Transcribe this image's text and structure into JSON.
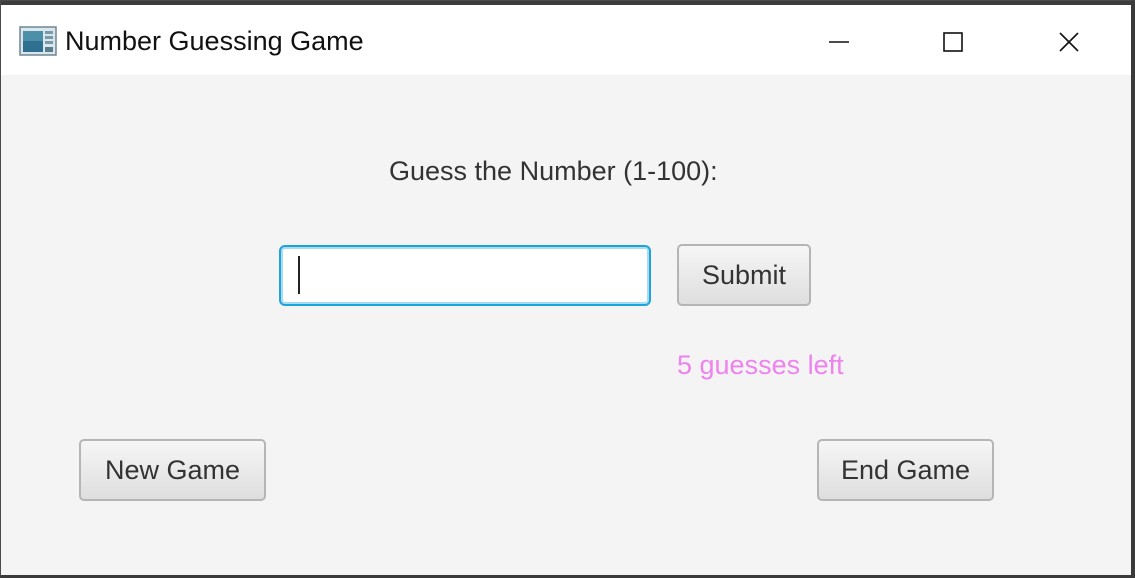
{
  "window": {
    "title": "Number Guessing Game",
    "controls": {
      "minimize": "minimize-icon",
      "maximize": "maximize-icon",
      "close": "close-icon"
    }
  },
  "game": {
    "prompt": "Guess the Number (1-100):",
    "guess_input": {
      "value": "",
      "placeholder": ""
    },
    "submit_label": "Submit",
    "status": "5 guesses left",
    "status_color": "#ee82ee",
    "new_game_label": "New Game",
    "end_game_label": "End Game"
  },
  "colors": {
    "background": "#f4f4f4",
    "focus_ring": "#1ea3dd",
    "text": "#333333"
  }
}
